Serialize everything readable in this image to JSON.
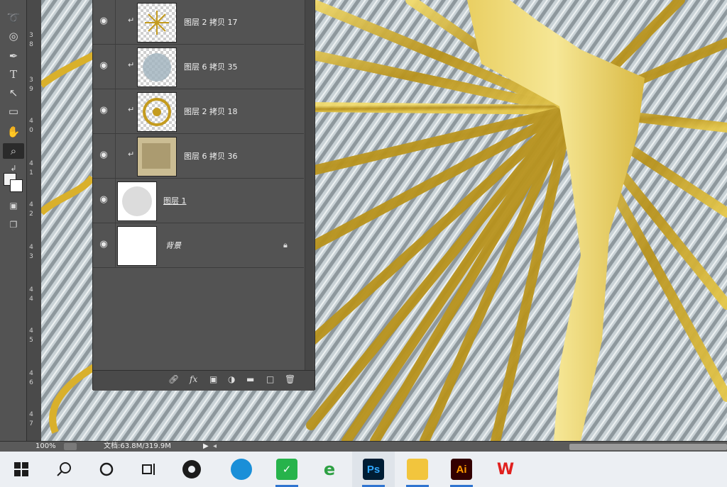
{
  "layers": [
    {
      "name": "图层 2 拷贝 17",
      "clipped": true
    },
    {
      "name": "图层 6 拷贝 35",
      "clipped": true
    },
    {
      "name": "图层 2 拷贝 18",
      "clipped": true
    },
    {
      "name": "图层 6 拷贝 36",
      "clipped": true
    },
    {
      "name": "图层 1",
      "clipped": false
    },
    {
      "name": "背景",
      "clipped": false,
      "locked": true
    }
  ],
  "ruler_ticks": [
    "3",
    "8",
    "3",
    "9",
    "4",
    "0",
    "4",
    "1",
    "4",
    "2",
    "4",
    "3",
    "4",
    "4",
    "4",
    "5",
    "4",
    "6",
    "4",
    "7"
  ],
  "status": {
    "zoom": "100%",
    "doc": "文档:63.8M/319.9M"
  },
  "taskbar_icons": [
    "windows-start-icon",
    "search-icon",
    "cortana-icon",
    "task-view-icon",
    "app-icon",
    "edge-icon",
    "green-app-icon",
    "ie-icon",
    "photoshop-icon",
    "file-explorer-icon",
    "illustrator-icon",
    "wps-icon"
  ],
  "taskbar_labels": {
    "ps": "Ps",
    "ai": "Ai",
    "wps": "W"
  },
  "colors": {
    "gold": "#c9a526",
    "ps_bg": "#535353",
    "ps_blue": "#2f74d0"
  }
}
